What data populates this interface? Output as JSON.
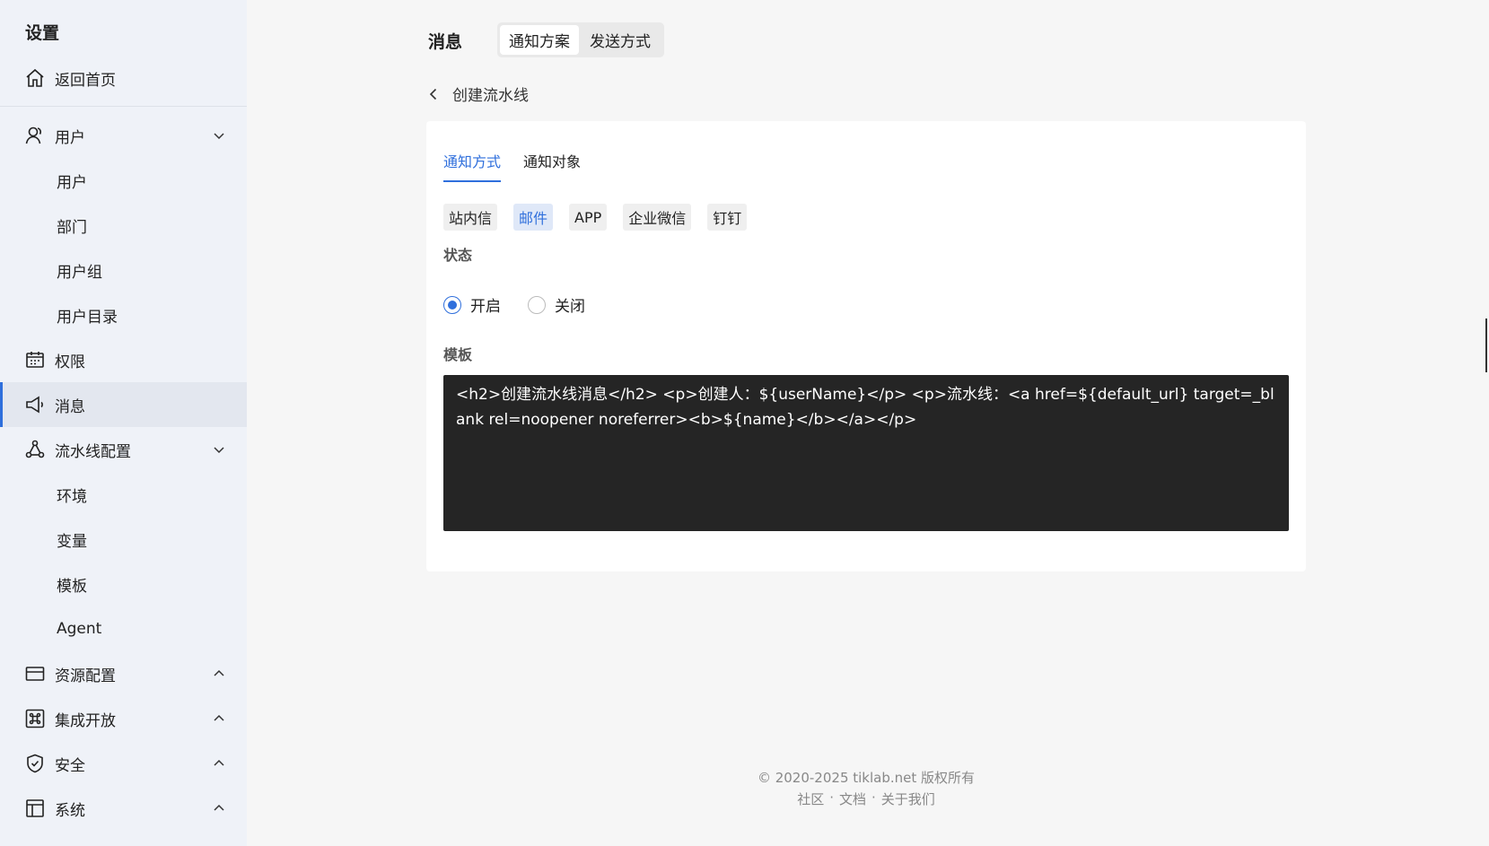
{
  "sidebar": {
    "title": "设置",
    "home": "返回首页",
    "user": "用户",
    "user_sub": [
      "用户",
      "部门",
      "用户组",
      "用户目录"
    ],
    "permission": "权限",
    "message": "消息",
    "pipeline": "流水线配置",
    "pipeline_sub": [
      "环境",
      "变量",
      "模板",
      "Agent"
    ],
    "resource": "资源配置",
    "integration": "集成开放",
    "security": "安全",
    "system": "系统"
  },
  "header": {
    "title": "消息",
    "seg_tabs": [
      "通知方案",
      "发送方式"
    ],
    "active_seg": "通知方案"
  },
  "back_label": "创建流水线",
  "card": {
    "tabs": [
      "通知方式",
      "通知对象"
    ],
    "active_tab": "通知方式",
    "channels": [
      "站内信",
      "邮件",
      "APP",
      "企业微信",
      "钉钉"
    ],
    "active_channel": "邮件",
    "status_label": "状态",
    "status_on": "开启",
    "status_off": "关闭",
    "status_value": "开启",
    "template_label": "模板",
    "template_value": "<h2>创建流水线消息</h2> <p>创建人：${userName}</p> <p>流水线：<a href=${default_url} target=_blank rel=noopener noreferrer><b>${name}</b></a></p>"
  },
  "footer": {
    "copyright": "© 2020-2025 tiklab.net 版权所有",
    "links": [
      "社区",
      "文档",
      "关于我们"
    ],
    "separator": "·"
  },
  "colors": {
    "accent": "#2f6fdc",
    "sidebar_bg": "#eff2f8",
    "editor_bg": "#252525"
  }
}
